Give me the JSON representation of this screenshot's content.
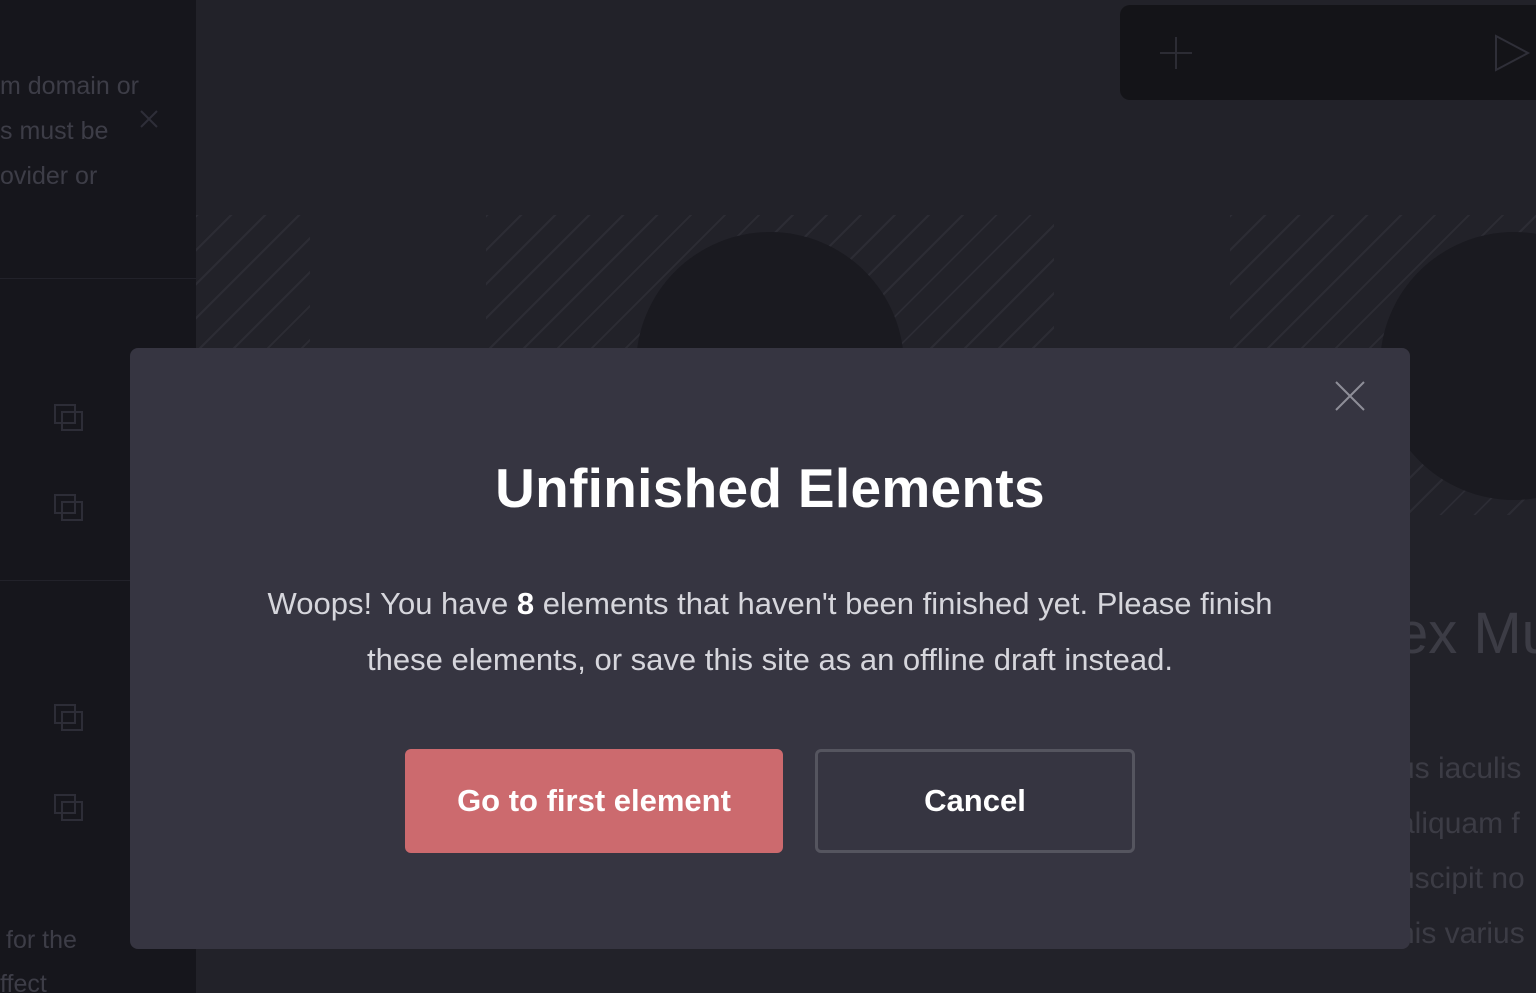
{
  "background": {
    "sidebar_lines": [
      "m domain or",
      "s must be",
      "ovider or",
      "for the",
      "ffect"
    ],
    "canvas_heading_fragment": "ex Mu",
    "canvas_paragraph_fragments": [
      "us iaculis",
      "aliquam f",
      "uscipit no",
      "nis varius"
    ]
  },
  "modal": {
    "title": "Unfinished Elements",
    "message_before": "Woops! You have ",
    "count": "8",
    "message_after": " elements that haven't been finished yet. Please finish these elements, or save this site as an offline draft instead.",
    "primary_button": "Go to first element",
    "secondary_button": "Cancel"
  },
  "colors": {
    "modal_bg": "#363541",
    "primary_button": "#cc6a6e",
    "page_bg": "#202028"
  },
  "icons": [
    "close-icon",
    "add-icon",
    "play-icon",
    "duplicate-icon"
  ]
}
